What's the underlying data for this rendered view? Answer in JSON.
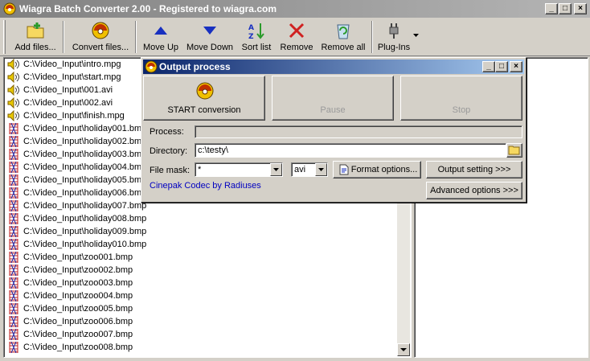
{
  "window": {
    "title": "Wiagra Batch Converter 2.00 - Registered to wiagra.com",
    "minimize": "_",
    "maximize": "□",
    "close": "×"
  },
  "toolbar": {
    "add_files": "Add files...",
    "convert_files": "Convert files...",
    "move_up": "Move Up",
    "move_down": "Move Down",
    "sort_list": "Sort list",
    "remove": "Remove",
    "remove_all": "Remove all",
    "plug_ins": "Plug-Ins"
  },
  "files": [
    {
      "name": "C:\\Video_Input\\intro.mpg",
      "type": "audio"
    },
    {
      "name": "C:\\Video_Input\\start.mpg",
      "type": "audio"
    },
    {
      "name": "C:\\Video_Input\\001.avi",
      "type": "audio"
    },
    {
      "name": "C:\\Video_Input\\002.avi",
      "type": "audio"
    },
    {
      "name": "C:\\Video_Input\\finish.mpg",
      "type": "audio"
    },
    {
      "name": "C:\\Video_Input\\holiday001.bmp",
      "type": "image"
    },
    {
      "name": "C:\\Video_Input\\holiday002.bmp",
      "type": "image"
    },
    {
      "name": "C:\\Video_Input\\holiday003.bmp",
      "type": "image"
    },
    {
      "name": "C:\\Video_Input\\holiday004.bmp",
      "type": "image"
    },
    {
      "name": "C:\\Video_Input\\holiday005.bmp",
      "type": "image"
    },
    {
      "name": "C:\\Video_Input\\holiday006.bmp",
      "type": "image"
    },
    {
      "name": "C:\\Video_Input\\holiday007.bmp",
      "type": "image"
    },
    {
      "name": "C:\\Video_Input\\holiday008.bmp",
      "type": "image"
    },
    {
      "name": "C:\\Video_Input\\holiday009.bmp",
      "type": "image"
    },
    {
      "name": "C:\\Video_Input\\holiday010.bmp",
      "type": "image"
    },
    {
      "name": "C:\\Video_Input\\zoo001.bmp",
      "type": "image"
    },
    {
      "name": "C:\\Video_Input\\zoo002.bmp",
      "type": "image"
    },
    {
      "name": "C:\\Video_Input\\zoo003.bmp",
      "type": "image"
    },
    {
      "name": "C:\\Video_Input\\zoo004.bmp",
      "type": "image"
    },
    {
      "name": "C:\\Video_Input\\zoo005.bmp",
      "type": "image"
    },
    {
      "name": "C:\\Video_Input\\zoo006.bmp",
      "type": "image"
    },
    {
      "name": "C:\\Video_Input\\zoo007.bmp",
      "type": "image"
    },
    {
      "name": "C:\\Video_Input\\zoo008.bmp",
      "type": "image"
    }
  ],
  "dialog": {
    "title": "Output process",
    "start_label": "START conversion",
    "pause_label": "Pause",
    "stop_label": "Stop",
    "process_label": "Process:",
    "directory_label": "Directory:",
    "directory_value": "c:\\testy\\",
    "file_mask_label": "File mask:",
    "file_mask_value": "*",
    "format_value": "avi",
    "format_options": "Format options...",
    "output_setting": "Output setting >>>",
    "advanced_options": "Advanced options >>>",
    "codec": "Cinepak Codec by Radiuses"
  },
  "colors": {
    "accent": "#0a246a",
    "codec_link": "#0000c0"
  }
}
